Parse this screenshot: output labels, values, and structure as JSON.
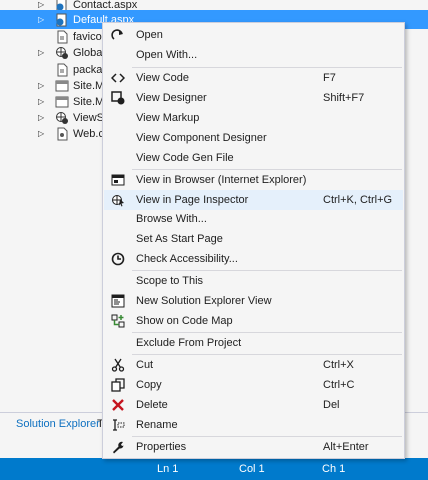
{
  "tree": {
    "items": [
      {
        "label": "Contact.aspx",
        "icon": "aspx-globe-icon"
      },
      {
        "label": "Default.aspx",
        "icon": "aspx-globe-icon"
      },
      {
        "label": "favicon",
        "icon": "file-icon"
      },
      {
        "label": "Global.",
        "icon": "globe-icon"
      },
      {
        "label": "packag",
        "icon": "file-icon"
      },
      {
        "label": "Site.Ma",
        "icon": "master-page-icon"
      },
      {
        "label": "Site.Mo",
        "icon": "master-page-icon"
      },
      {
        "label": "ViewSw",
        "icon": "globe-icon"
      },
      {
        "label": "Web.co",
        "icon": "config-icon"
      }
    ]
  },
  "tabs": {
    "solution_explorer": "Solution Explorer",
    "other": "T"
  },
  "statusbar": {
    "ln": "Ln 1",
    "col": "Col 1",
    "ch": "Ch 1",
    "color": "#007acc"
  },
  "menu": {
    "highlight_color": "#e5f0fb",
    "items": [
      {
        "label": "Open",
        "shortcut": "",
        "icon": "open-arrow-icon"
      },
      {
        "label": "Open With...",
        "shortcut": "",
        "icon": ""
      },
      {
        "label": "View Code",
        "shortcut": "F7",
        "icon": "code-brackets-icon"
      },
      {
        "label": "View Designer",
        "shortcut": "Shift+F7",
        "icon": "designer-icon"
      },
      {
        "label": "View Markup",
        "shortcut": "",
        "icon": ""
      },
      {
        "label": "View Component Designer",
        "shortcut": "",
        "icon": ""
      },
      {
        "label": "View Code Gen File",
        "shortcut": "",
        "icon": ""
      },
      {
        "label": "View in Browser (Internet Explorer)",
        "shortcut": "",
        "icon": "browser-icon"
      },
      {
        "label": "View in Page Inspector",
        "shortcut": "Ctrl+K, Ctrl+G",
        "icon": "page-inspector-icon"
      },
      {
        "label": "Browse With...",
        "shortcut": "",
        "icon": ""
      },
      {
        "label": "Set As Start Page",
        "shortcut": "",
        "icon": ""
      },
      {
        "label": "Check Accessibility...",
        "shortcut": "",
        "icon": "accessibility-icon"
      },
      {
        "label": "Scope to This",
        "shortcut": "",
        "icon": ""
      },
      {
        "label": "New Solution Explorer View",
        "shortcut": "",
        "icon": "new-view-icon"
      },
      {
        "label": "Show on Code Map",
        "shortcut": "",
        "icon": "code-map-icon"
      },
      {
        "label": "Exclude From Project",
        "shortcut": "",
        "icon": ""
      },
      {
        "label": "Cut",
        "shortcut": "Ctrl+X",
        "icon": "scissors-icon"
      },
      {
        "label": "Copy",
        "shortcut": "Ctrl+C",
        "icon": "copy-icon"
      },
      {
        "label": "Delete",
        "shortcut": "Del",
        "icon": "delete-x-icon"
      },
      {
        "label": "Rename",
        "shortcut": "",
        "icon": "rename-icon"
      },
      {
        "label": "Properties",
        "shortcut": "Alt+Enter",
        "icon": "wrench-icon"
      }
    ]
  }
}
